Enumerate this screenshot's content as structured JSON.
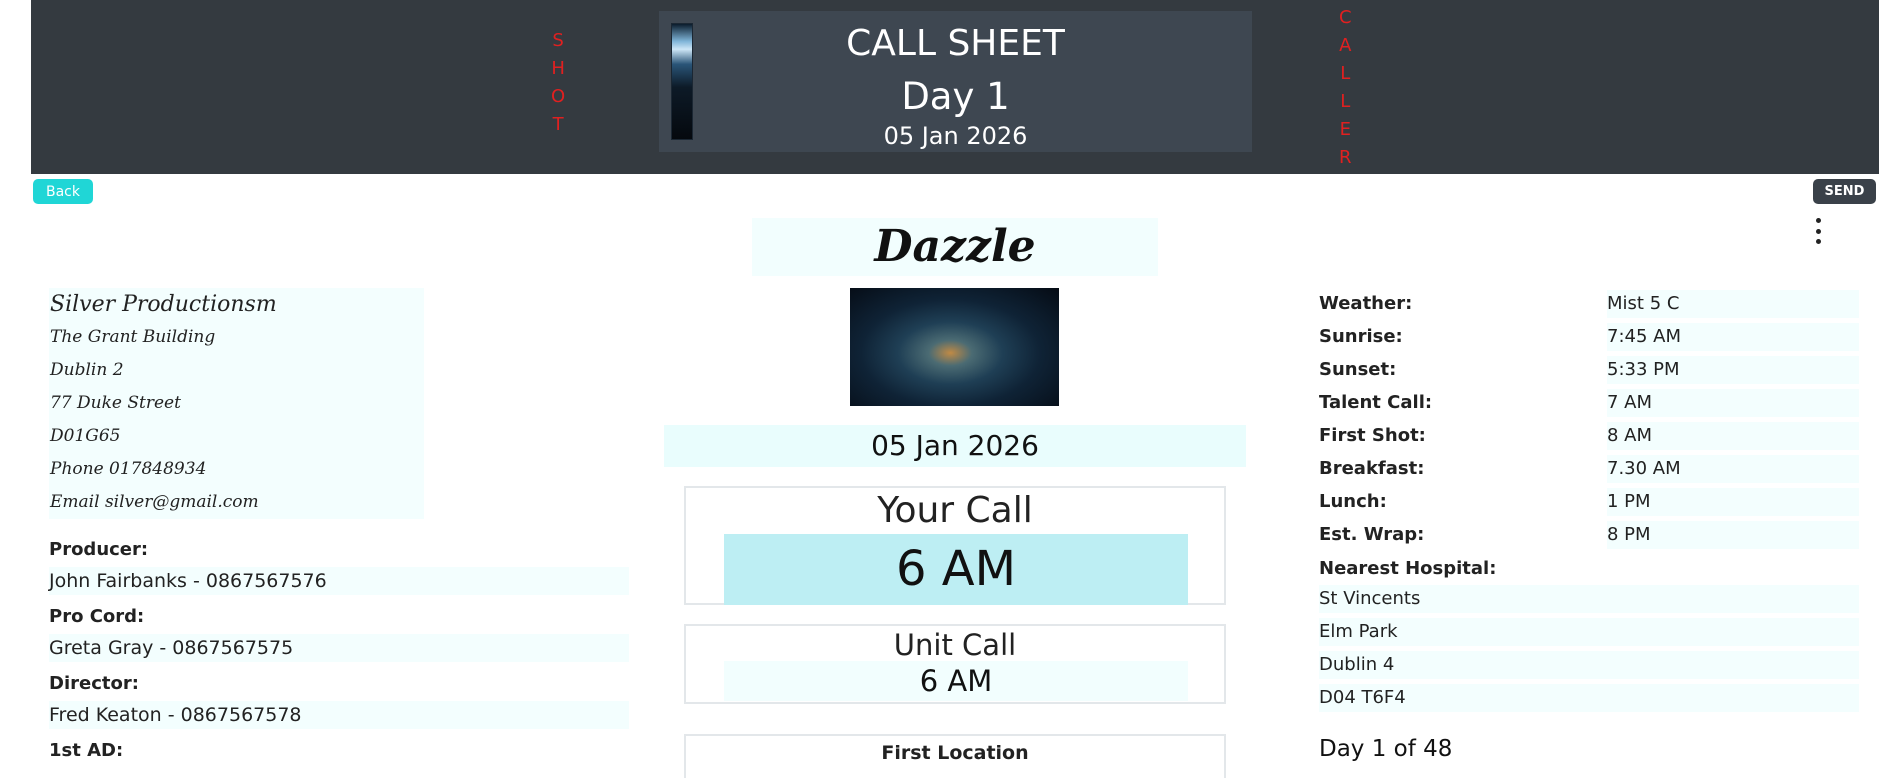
{
  "header": {
    "shot_letters": [
      "S",
      "H",
      "O",
      "T"
    ],
    "caller_letters": [
      "C",
      "A",
      "L",
      "L",
      "E",
      "R"
    ],
    "title": "CALL SHEET",
    "day": "Day 1",
    "date": "05 Jan 2026"
  },
  "buttons": {
    "back": "Back",
    "send": "SEND"
  },
  "project": {
    "title": "Dazzle",
    "date": "05 Jan 2026",
    "your_call_label": "Your Call",
    "your_call_value": "6 AM",
    "unit_call_label": "Unit Call",
    "unit_call_value": "6 AM",
    "first_location_label": "First Location"
  },
  "company": {
    "name": "Silver Productionsm",
    "address_lines": [
      "The Grant Building",
      "Dublin 2",
      "77 Duke Street",
      "D01G65",
      "Phone 017848934",
      "Email silver@gmail.com"
    ]
  },
  "crew": [
    {
      "label": "Producer:",
      "value": "John Fairbanks - 0867567576"
    },
    {
      "label": "Pro Cord:",
      "value": "Greta Gray - 0867567575"
    },
    {
      "label": "Director:",
      "value": "Fred Keaton - 0867567578"
    },
    {
      "label": "1st AD:",
      "value": ""
    }
  ],
  "info": [
    {
      "key": "Weather:",
      "value": "Mist 5 C"
    },
    {
      "key": "Sunrise:",
      "value": "7:45 AM"
    },
    {
      "key": "Sunset:",
      "value": "5:33 PM"
    },
    {
      "key": "Talent Call:",
      "value": "7 AM"
    },
    {
      "key": "First Shot:",
      "value": "8 AM"
    },
    {
      "key": "Breakfast:",
      "value": "7.30 AM"
    },
    {
      "key": "Lunch:",
      "value": "1 PM"
    },
    {
      "key": "Est. Wrap:",
      "value": "8 PM"
    }
  ],
  "hospital": {
    "label": "Nearest Hospital:",
    "lines": [
      "St Vincents",
      "Elm Park",
      "Dublin 4",
      "D04 T6F4"
    ]
  },
  "day_of": "Day 1 of 48",
  "colors": {
    "header_bg": "#343a40",
    "accent_red": "#e02020",
    "back_button": "#20d6d6",
    "call_highlight": "#bdeef3"
  }
}
